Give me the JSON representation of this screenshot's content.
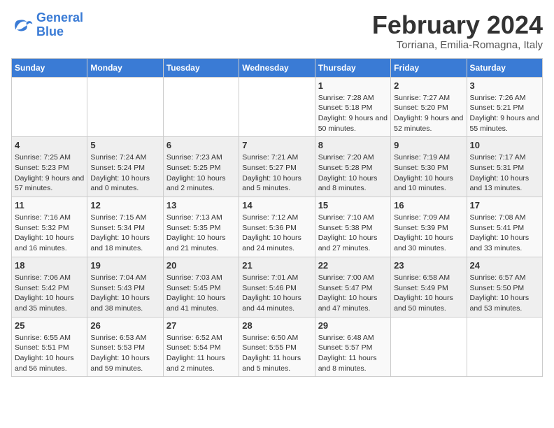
{
  "logo": {
    "line1": "General",
    "line2": "Blue"
  },
  "title": "February 2024",
  "subtitle": "Torriana, Emilia-Romagna, Italy",
  "days_header": [
    "Sunday",
    "Monday",
    "Tuesday",
    "Wednesday",
    "Thursday",
    "Friday",
    "Saturday"
  ],
  "weeks": [
    [
      {
        "day": "",
        "info": ""
      },
      {
        "day": "",
        "info": ""
      },
      {
        "day": "",
        "info": ""
      },
      {
        "day": "",
        "info": ""
      },
      {
        "day": "1",
        "info": "Sunrise: 7:28 AM\nSunset: 5:18 PM\nDaylight: 9 hours and 50 minutes."
      },
      {
        "day": "2",
        "info": "Sunrise: 7:27 AM\nSunset: 5:20 PM\nDaylight: 9 hours and 52 minutes."
      },
      {
        "day": "3",
        "info": "Sunrise: 7:26 AM\nSunset: 5:21 PM\nDaylight: 9 hours and 55 minutes."
      }
    ],
    [
      {
        "day": "4",
        "info": "Sunrise: 7:25 AM\nSunset: 5:23 PM\nDaylight: 9 hours and 57 minutes."
      },
      {
        "day": "5",
        "info": "Sunrise: 7:24 AM\nSunset: 5:24 PM\nDaylight: 10 hours and 0 minutes."
      },
      {
        "day": "6",
        "info": "Sunrise: 7:23 AM\nSunset: 5:25 PM\nDaylight: 10 hours and 2 minutes."
      },
      {
        "day": "7",
        "info": "Sunrise: 7:21 AM\nSunset: 5:27 PM\nDaylight: 10 hours and 5 minutes."
      },
      {
        "day": "8",
        "info": "Sunrise: 7:20 AM\nSunset: 5:28 PM\nDaylight: 10 hours and 8 minutes."
      },
      {
        "day": "9",
        "info": "Sunrise: 7:19 AM\nSunset: 5:30 PM\nDaylight: 10 hours and 10 minutes."
      },
      {
        "day": "10",
        "info": "Sunrise: 7:17 AM\nSunset: 5:31 PM\nDaylight: 10 hours and 13 minutes."
      }
    ],
    [
      {
        "day": "11",
        "info": "Sunrise: 7:16 AM\nSunset: 5:32 PM\nDaylight: 10 hours and 16 minutes."
      },
      {
        "day": "12",
        "info": "Sunrise: 7:15 AM\nSunset: 5:34 PM\nDaylight: 10 hours and 18 minutes."
      },
      {
        "day": "13",
        "info": "Sunrise: 7:13 AM\nSunset: 5:35 PM\nDaylight: 10 hours and 21 minutes."
      },
      {
        "day": "14",
        "info": "Sunrise: 7:12 AM\nSunset: 5:36 PM\nDaylight: 10 hours and 24 minutes."
      },
      {
        "day": "15",
        "info": "Sunrise: 7:10 AM\nSunset: 5:38 PM\nDaylight: 10 hours and 27 minutes."
      },
      {
        "day": "16",
        "info": "Sunrise: 7:09 AM\nSunset: 5:39 PM\nDaylight: 10 hours and 30 minutes."
      },
      {
        "day": "17",
        "info": "Sunrise: 7:08 AM\nSunset: 5:41 PM\nDaylight: 10 hours and 33 minutes."
      }
    ],
    [
      {
        "day": "18",
        "info": "Sunrise: 7:06 AM\nSunset: 5:42 PM\nDaylight: 10 hours and 35 minutes."
      },
      {
        "day": "19",
        "info": "Sunrise: 7:04 AM\nSunset: 5:43 PM\nDaylight: 10 hours and 38 minutes."
      },
      {
        "day": "20",
        "info": "Sunrise: 7:03 AM\nSunset: 5:45 PM\nDaylight: 10 hours and 41 minutes."
      },
      {
        "day": "21",
        "info": "Sunrise: 7:01 AM\nSunset: 5:46 PM\nDaylight: 10 hours and 44 minutes."
      },
      {
        "day": "22",
        "info": "Sunrise: 7:00 AM\nSunset: 5:47 PM\nDaylight: 10 hours and 47 minutes."
      },
      {
        "day": "23",
        "info": "Sunrise: 6:58 AM\nSunset: 5:49 PM\nDaylight: 10 hours and 50 minutes."
      },
      {
        "day": "24",
        "info": "Sunrise: 6:57 AM\nSunset: 5:50 PM\nDaylight: 10 hours and 53 minutes."
      }
    ],
    [
      {
        "day": "25",
        "info": "Sunrise: 6:55 AM\nSunset: 5:51 PM\nDaylight: 10 hours and 56 minutes."
      },
      {
        "day": "26",
        "info": "Sunrise: 6:53 AM\nSunset: 5:53 PM\nDaylight: 10 hours and 59 minutes."
      },
      {
        "day": "27",
        "info": "Sunrise: 6:52 AM\nSunset: 5:54 PM\nDaylight: 11 hours and 2 minutes."
      },
      {
        "day": "28",
        "info": "Sunrise: 6:50 AM\nSunset: 5:55 PM\nDaylight: 11 hours and 5 minutes."
      },
      {
        "day": "29",
        "info": "Sunrise: 6:48 AM\nSunset: 5:57 PM\nDaylight: 11 hours and 8 minutes."
      },
      {
        "day": "",
        "info": ""
      },
      {
        "day": "",
        "info": ""
      }
    ]
  ]
}
